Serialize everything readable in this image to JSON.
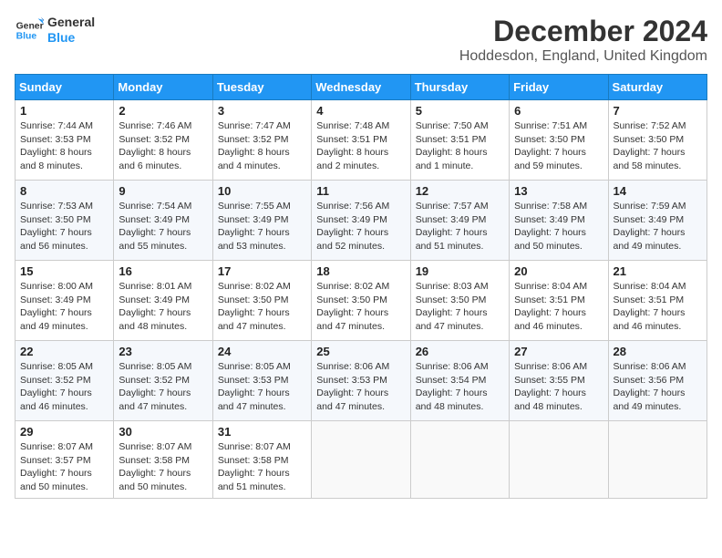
{
  "logo": {
    "line1": "General",
    "line2": "Blue"
  },
  "title": "December 2024",
  "location": "Hoddesdon, England, United Kingdom",
  "weekdays": [
    "Sunday",
    "Monday",
    "Tuesday",
    "Wednesday",
    "Thursday",
    "Friday",
    "Saturday"
  ],
  "weeks": [
    [
      {
        "day": "1",
        "sunrise": "7:44 AM",
        "sunset": "3:53 PM",
        "daylight": "8 hours and 8 minutes."
      },
      {
        "day": "2",
        "sunrise": "7:46 AM",
        "sunset": "3:52 PM",
        "daylight": "8 hours and 6 minutes."
      },
      {
        "day": "3",
        "sunrise": "7:47 AM",
        "sunset": "3:52 PM",
        "daylight": "8 hours and 4 minutes."
      },
      {
        "day": "4",
        "sunrise": "7:48 AM",
        "sunset": "3:51 PM",
        "daylight": "8 hours and 2 minutes."
      },
      {
        "day": "5",
        "sunrise": "7:50 AM",
        "sunset": "3:51 PM",
        "daylight": "8 hours and 1 minute."
      },
      {
        "day": "6",
        "sunrise": "7:51 AM",
        "sunset": "3:50 PM",
        "daylight": "7 hours and 59 minutes."
      },
      {
        "day": "7",
        "sunrise": "7:52 AM",
        "sunset": "3:50 PM",
        "daylight": "7 hours and 58 minutes."
      }
    ],
    [
      {
        "day": "8",
        "sunrise": "7:53 AM",
        "sunset": "3:50 PM",
        "daylight": "7 hours and 56 minutes."
      },
      {
        "day": "9",
        "sunrise": "7:54 AM",
        "sunset": "3:49 PM",
        "daylight": "7 hours and 55 minutes."
      },
      {
        "day": "10",
        "sunrise": "7:55 AM",
        "sunset": "3:49 PM",
        "daylight": "7 hours and 53 minutes."
      },
      {
        "day": "11",
        "sunrise": "7:56 AM",
        "sunset": "3:49 PM",
        "daylight": "7 hours and 52 minutes."
      },
      {
        "day": "12",
        "sunrise": "7:57 AM",
        "sunset": "3:49 PM",
        "daylight": "7 hours and 51 minutes."
      },
      {
        "day": "13",
        "sunrise": "7:58 AM",
        "sunset": "3:49 PM",
        "daylight": "7 hours and 50 minutes."
      },
      {
        "day": "14",
        "sunrise": "7:59 AM",
        "sunset": "3:49 PM",
        "daylight": "7 hours and 49 minutes."
      }
    ],
    [
      {
        "day": "15",
        "sunrise": "8:00 AM",
        "sunset": "3:49 PM",
        "daylight": "7 hours and 49 minutes."
      },
      {
        "day": "16",
        "sunrise": "8:01 AM",
        "sunset": "3:49 PM",
        "daylight": "7 hours and 48 minutes."
      },
      {
        "day": "17",
        "sunrise": "8:02 AM",
        "sunset": "3:50 PM",
        "daylight": "7 hours and 47 minutes."
      },
      {
        "day": "18",
        "sunrise": "8:02 AM",
        "sunset": "3:50 PM",
        "daylight": "7 hours and 47 minutes."
      },
      {
        "day": "19",
        "sunrise": "8:03 AM",
        "sunset": "3:50 PM",
        "daylight": "7 hours and 47 minutes."
      },
      {
        "day": "20",
        "sunrise": "8:04 AM",
        "sunset": "3:51 PM",
        "daylight": "7 hours and 46 minutes."
      },
      {
        "day": "21",
        "sunrise": "8:04 AM",
        "sunset": "3:51 PM",
        "daylight": "7 hours and 46 minutes."
      }
    ],
    [
      {
        "day": "22",
        "sunrise": "8:05 AM",
        "sunset": "3:52 PM",
        "daylight": "7 hours and 46 minutes."
      },
      {
        "day": "23",
        "sunrise": "8:05 AM",
        "sunset": "3:52 PM",
        "daylight": "7 hours and 47 minutes."
      },
      {
        "day": "24",
        "sunrise": "8:05 AM",
        "sunset": "3:53 PM",
        "daylight": "7 hours and 47 minutes."
      },
      {
        "day": "25",
        "sunrise": "8:06 AM",
        "sunset": "3:53 PM",
        "daylight": "7 hours and 47 minutes."
      },
      {
        "day": "26",
        "sunrise": "8:06 AM",
        "sunset": "3:54 PM",
        "daylight": "7 hours and 48 minutes."
      },
      {
        "day": "27",
        "sunrise": "8:06 AM",
        "sunset": "3:55 PM",
        "daylight": "7 hours and 48 minutes."
      },
      {
        "day": "28",
        "sunrise": "8:06 AM",
        "sunset": "3:56 PM",
        "daylight": "7 hours and 49 minutes."
      }
    ],
    [
      {
        "day": "29",
        "sunrise": "8:07 AM",
        "sunset": "3:57 PM",
        "daylight": "7 hours and 50 minutes."
      },
      {
        "day": "30",
        "sunrise": "8:07 AM",
        "sunset": "3:58 PM",
        "daylight": "7 hours and 50 minutes."
      },
      {
        "day": "31",
        "sunrise": "8:07 AM",
        "sunset": "3:58 PM",
        "daylight": "7 hours and 51 minutes."
      },
      null,
      null,
      null,
      null
    ]
  ],
  "labels": {
    "sunrise": "Sunrise:",
    "sunset": "Sunset:",
    "daylight": "Daylight:"
  }
}
